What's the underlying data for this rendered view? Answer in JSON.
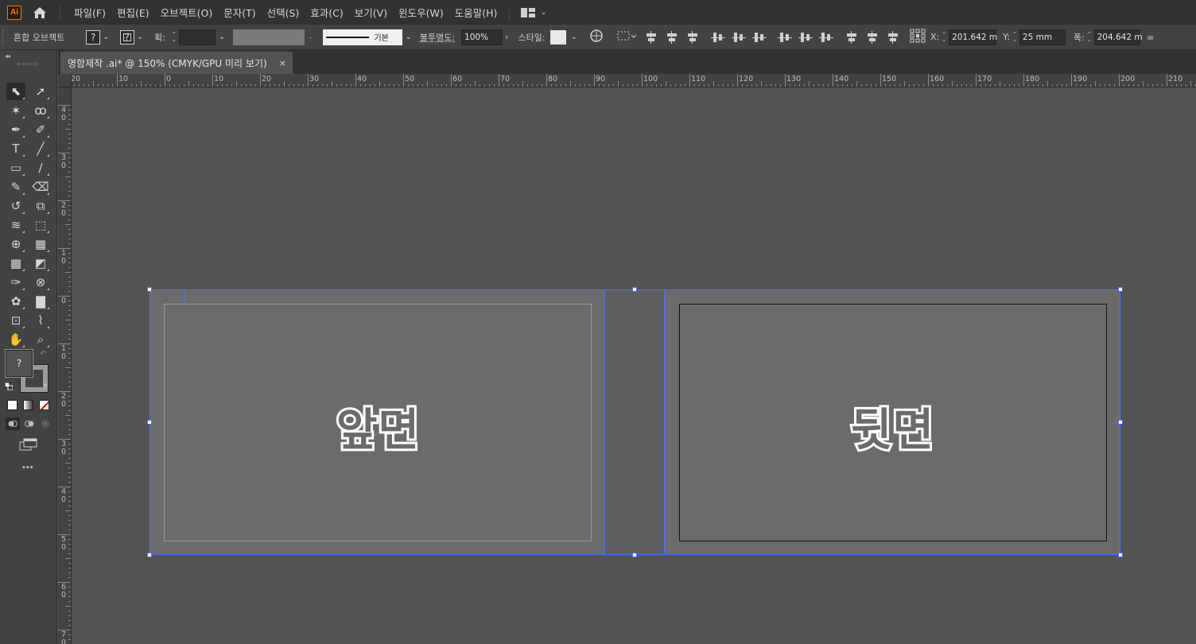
{
  "menubar": {
    "app_logo": "Ai",
    "items": [
      "파일(F)",
      "편집(E)",
      "오브젝트(O)",
      "문자(T)",
      "선택(S)",
      "효과(C)",
      "보기(V)",
      "윈도우(W)",
      "도움말(H)"
    ]
  },
  "controlbar": {
    "object_type": "혼합 오브젝트",
    "fill_value": "?",
    "stroke_value": "?",
    "stroke_weight_label": "획:",
    "brush_label": "기본",
    "opacity_label": "불투명도:",
    "opacity_value": "100%",
    "style_label": "스타일:",
    "x_label": "X:",
    "x_value": "201.642 m",
    "y_label": "Y:",
    "y_value": "25 mm",
    "width_label": "폭:",
    "width_value": "204.642 m"
  },
  "document_tab": {
    "title": "명함제작 .ai* @ 150% (CMYK/GPU 미리 보기)",
    "close": "×"
  },
  "ruler": {
    "h_labels": [
      "20",
      "10",
      "0",
      "10",
      "20",
      "30",
      "40",
      "50",
      "60",
      "70",
      "80",
      "90",
      "100",
      "110",
      "120",
      "130",
      "140",
      "150",
      "160",
      "170",
      "180",
      "190",
      "200",
      "210"
    ],
    "v_labels": [
      "40",
      "30",
      "20",
      "10",
      "0",
      "10",
      "20",
      "30",
      "40",
      "50",
      "60",
      "70"
    ]
  },
  "tools": {
    "fill_q": "?",
    "stroke_q": "?",
    "more": "•••",
    "icons": [
      "selection-tool",
      "direct-selection-tool",
      "magic-wand-tool",
      "lasso-tool",
      "pen-tool",
      "curvature-tool",
      "type-tool",
      "line-segment-tool",
      "rectangle-tool",
      "paintbrush-tool",
      "shaper-tool",
      "eraser-tool",
      "rotate-tool",
      "scale-tool",
      "width-tool",
      "free-transform-tool",
      "shape-builder-tool",
      "perspective-grid-tool",
      "mesh-tool",
      "gradient-tool",
      "eyedropper-tool",
      "blend-tool",
      "symbol-sprayer-tool",
      "column-graph-tool",
      "artboard-tool",
      "slice-tool",
      "hand-tool",
      "zoom-tool"
    ]
  },
  "canvas": {
    "front_label": "앞면",
    "back_label": "뒷면"
  }
}
